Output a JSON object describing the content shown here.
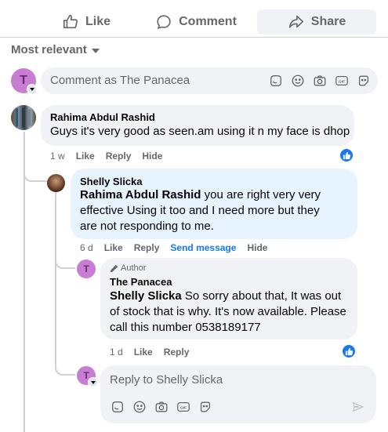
{
  "actions": {
    "like_label": "Like",
    "comment_label": "Comment",
    "share_label": "Share"
  },
  "sort": {
    "label": "Most relevant"
  },
  "top_composer": {
    "avatar_letter": "T",
    "placeholder": "Comment as The Panacea"
  },
  "comments": [
    {
      "author": "Rahima Abdul Rashid",
      "text": "Guys it's very good as seen.am using it n my face is dhop",
      "time": "1 w",
      "like": "Like",
      "reply": "Reply",
      "hide": "Hide"
    }
  ],
  "reply1": {
    "author": "Shelly Slicka",
    "mention": "Rahima Abdul Rashid",
    "text": " you are right very very effective Using it too and I need more but they are not responding to me.",
    "time": "6 d",
    "like": "Like",
    "reply": "Reply",
    "send_message": "Send message",
    "hide": "Hide"
  },
  "reply2": {
    "badge": "Author",
    "author": "The Panacea",
    "avatar_letter": "T",
    "mention": "Shelly Slicka",
    "text": " So sorry about that, It was out of stock that is why. It's now available. Please call this number 0538189177",
    "time": "1 d",
    "like": "Like",
    "reply": "Reply"
  },
  "reply_composer": {
    "avatar_letter": "T",
    "placeholder": "Reply to Shelly Slicka"
  },
  "colors": {
    "accent": "#1877f2",
    "avatar_bg": "#c77dd1",
    "highlight_bubble": "#e7f3ff"
  },
  "icons": [
    "like-icon",
    "comment-icon",
    "share-icon",
    "caret-down-icon",
    "sticker-icon",
    "emoji-icon",
    "camera-icon",
    "gif-icon",
    "avatar-sticker-icon",
    "pencil-icon",
    "send-icon",
    "thumbs-up-reaction-icon"
  ]
}
